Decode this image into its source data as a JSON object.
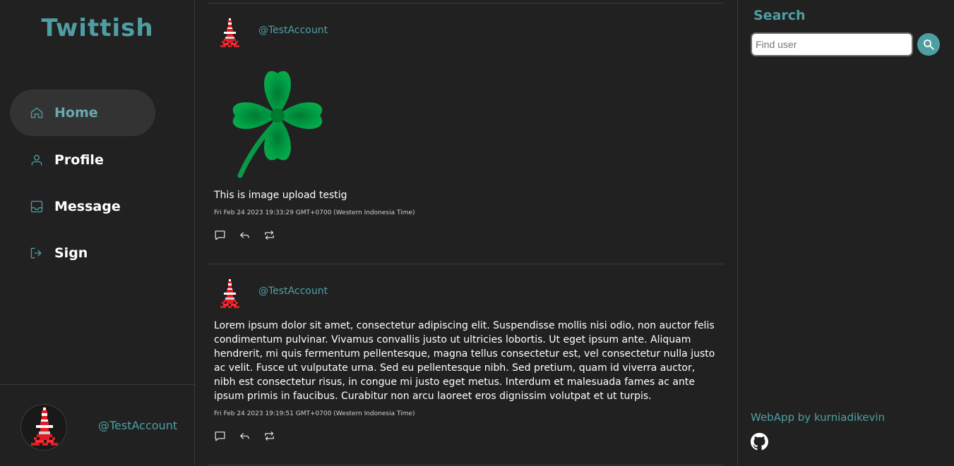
{
  "app": {
    "title": "Twittish"
  },
  "nav": {
    "items": [
      {
        "label": "Home",
        "icon": "home-icon",
        "active": true
      },
      {
        "label": "Profile",
        "icon": "user-icon",
        "active": false
      },
      {
        "label": "Message",
        "icon": "inbox-icon",
        "active": false
      },
      {
        "label": "Sign",
        "icon": "sign-in-icon",
        "active": false
      }
    ]
  },
  "account": {
    "handle": "@TestAccount"
  },
  "posts": [
    {
      "handle": "@TestAccount",
      "image": "four-leaf-clover",
      "text": "This is image upload testig",
      "timestamp": "Fri Feb 24 2023 19:33:29 GMT+0700 (Western Indonesia Time)"
    },
    {
      "handle": "@TestAccount",
      "text": "Lorem ipsum dolor sit amet, consectetur adipiscing elit. Suspendisse mollis nisi odio, non auctor felis condimentum pulvinar. Vivamus convallis justo ut ultricies lobortis. Ut eget ipsum ante. Aliquam hendrerit, mi quis fermentum pellentesque, magna tellus consectetur est, vel consectetur nulla justo ac velit. Fusce ut vulputate urna. Sed eu pellentesque nibh. Sed pretium, quam id viverra auctor, nibh est consectetur risus, in congue mi justo eget metus. Interdum et malesuada fames ac ante ipsum primis in faucibus. Curabitur non arcu laoreet eros dignissim volutpat et ut turpis.",
      "timestamp": "Fri Feb 24 2023 19:19:51 GMT+0700 (Western Indonesia Time)"
    }
  ],
  "search": {
    "title": "Search",
    "placeholder": "Find user",
    "value": ""
  },
  "footer": {
    "credit": "WebApp by kurniadikevin"
  },
  "colors": {
    "accent": "#4e9fa3",
    "background": "#212121",
    "active_nav": "#333333"
  }
}
